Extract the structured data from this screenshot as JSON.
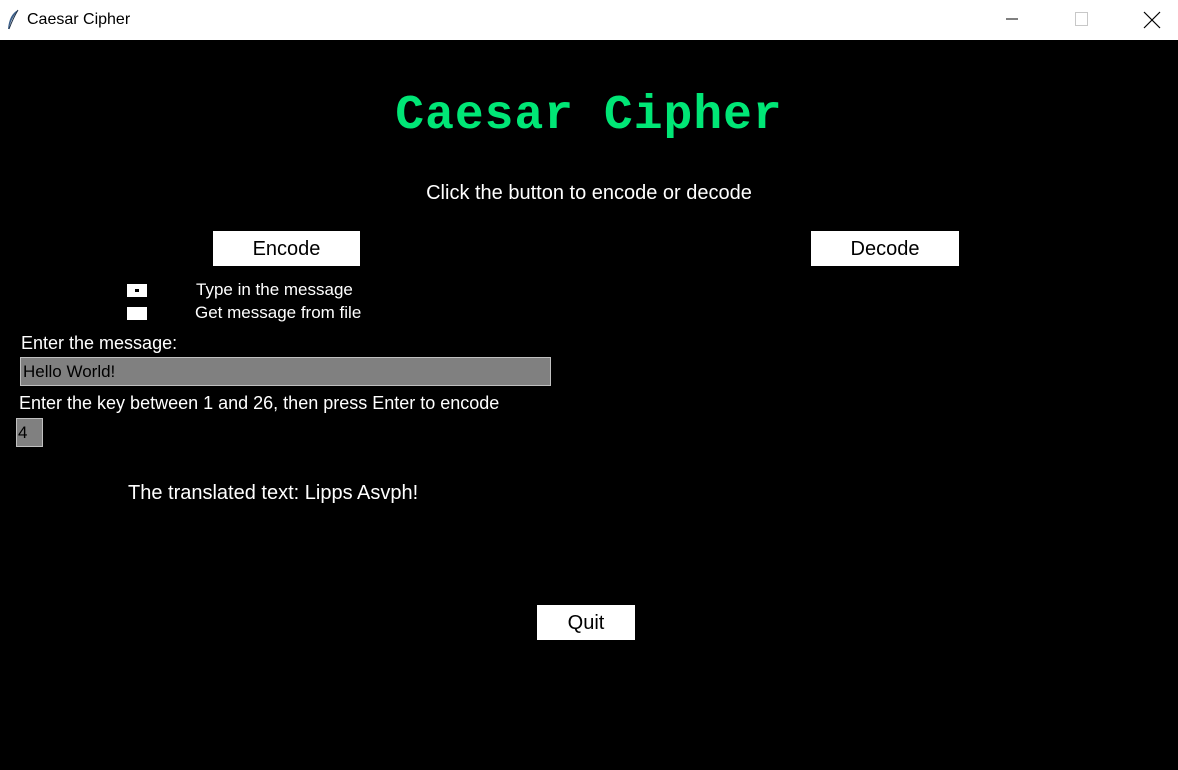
{
  "window": {
    "title": "Caesar Cipher",
    "app_icon": "feather-icon",
    "controls": [
      "minimize-icon",
      "maximize-icon",
      "close-icon"
    ]
  },
  "app": {
    "heading": "Caesar Cipher",
    "heading_color": "#00e676",
    "instruction": "Click the button to encode or decode",
    "buttons": {
      "encode": "Encode",
      "decode": "Decode",
      "quit": "Quit"
    },
    "source_options": [
      {
        "label": "Type in the message",
        "selected": true
      },
      {
        "label": "Get message from file",
        "selected": false
      }
    ],
    "message_label": "Enter the message:",
    "message_value": "Hello World!",
    "key_label": "Enter the key between 1 and 26, then press Enter to encode",
    "key_value": "4",
    "result_text": "The translated text: Lipps Asvph!"
  },
  "colors": {
    "background": "#000000",
    "accent": "#00e676",
    "entry_background": "#808080",
    "button_background": "#ffffff"
  }
}
